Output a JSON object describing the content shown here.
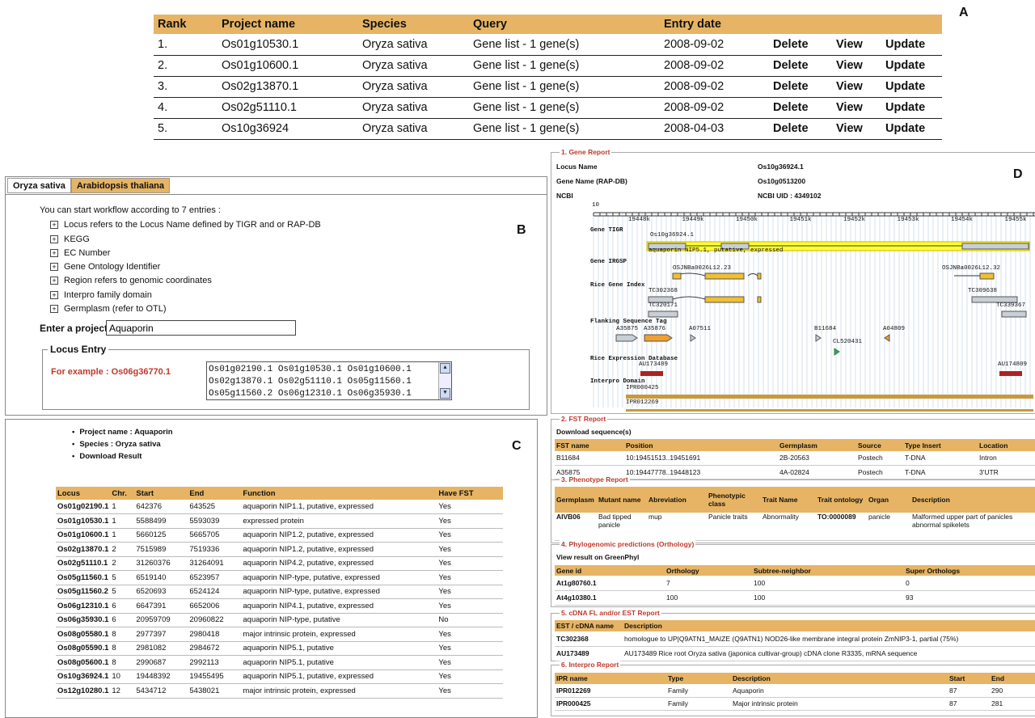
{
  "letters": {
    "a": "A",
    "b": "B",
    "c": "C",
    "d": "D"
  },
  "panelA": {
    "headers": [
      "Rank",
      "Project name",
      "Species",
      "Query",
      "Entry date",
      "",
      "",
      ""
    ],
    "rows": [
      [
        "1.",
        "Os01g10530.1",
        "Oryza sativa",
        "Gene list - 1 gene(s)",
        "2008-09-02",
        "Delete",
        "View",
        "Update"
      ],
      [
        "2.",
        "Os01g10600.1",
        "Oryza sativa",
        "Gene list - 1 gene(s)",
        "2008-09-02",
        "Delete",
        "View",
        "Update"
      ],
      [
        "3.",
        "Os02g13870.1",
        "Oryza sativa",
        "Gene list - 1 gene(s)",
        "2008-09-02",
        "Delete",
        "View",
        "Update"
      ],
      [
        "4.",
        "Os02g51110.1",
        "Oryza sativa",
        "Gene list - 1 gene(s)",
        "2008-09-02",
        "Delete",
        "View",
        "Update"
      ],
      [
        "5.",
        "Os10g36924",
        "Oryza sativa",
        "Gene list - 1 gene(s)",
        "2008-04-03",
        "Delete",
        "View",
        "Update"
      ]
    ]
  },
  "panelB": {
    "tabs": [
      "Oryza sativa",
      "Arabidopsis thaliana"
    ],
    "intro": "You can start workflow according to 7 entries :",
    "items": [
      "Locus refers to the Locus Name defined by TIGR and or RAP-DB",
      "KEGG",
      "EC Number",
      "Gene Ontology Identifier",
      "Region refers to genomic coordinates",
      "Interpro family domain",
      "Germplasm (refer to OTL)"
    ],
    "enter_label": "Enter a project",
    "enter_value": "Aquaporin",
    "locus_label": "Locus Entry",
    "example": "For example : Os06g36770.1",
    "locus_lines": [
      "Os01g02190.1 Os01g10530.1 Os01g10600.1",
      "Os02g13870.1 Os02g51110.1 Os05g11560.1",
      "Os05g11560.2 Os06g12310.1 Os06g35930.1"
    ]
  },
  "panelC": {
    "bullets": [
      "Project name : Aquaporin",
      "Species : Oryza sativa",
      "Download Result"
    ],
    "headers": [
      "Locus",
      "Chr.",
      "Start",
      "End",
      "Function",
      "Have FST"
    ],
    "rows": [
      [
        "Os01g02190.1",
        "1",
        "642376",
        "643525",
        "aquaporin NIP1.1, putative, expressed",
        "Yes"
      ],
      [
        "Os01g10530.1",
        "1",
        "5588499",
        "5593039",
        "expressed protein",
        "Yes"
      ],
      [
        "Os01g10600.1",
        "1",
        "5660125",
        "5665705",
        "aquaporin NIP1.2, putative, expressed",
        "Yes"
      ],
      [
        "Os02g13870.1",
        "2",
        "7515989",
        "7519336",
        "aquaporin NIP1.2, putative, expressed",
        "Yes"
      ],
      [
        "Os02g51110.1",
        "2",
        "31260376",
        "31264091",
        "aquaporin NIP4.2, putative, expressed",
        "Yes"
      ],
      [
        "Os05g11560.1",
        "5",
        "6519140",
        "6523957",
        "aquaporin NIP-type, putative, expressed",
        "Yes"
      ],
      [
        "Os05g11560.2",
        "5",
        "6520693",
        "6524124",
        "aquaporin NIP-type, putative, expressed",
        "Yes"
      ],
      [
        "Os06g12310.1",
        "6",
        "6647391",
        "6652006",
        "aquaporin NIP4.1, putative, expressed",
        "Yes"
      ],
      [
        "Os06g35930.1",
        "6",
        "20959709",
        "20960822",
        "aquaporin NIP-type, putative",
        "No"
      ],
      [
        "Os08g05580.1",
        "8",
        "2977397",
        "2980418",
        "major intrinsic protein, expressed",
        "Yes"
      ],
      [
        "Os08g05590.1",
        "8",
        "2981082",
        "2984672",
        "aquaporin NIP5.1, putative",
        "Yes"
      ],
      [
        "Os08g05600.1",
        "8",
        "2990687",
        "2992113",
        "aquaporin NIP5.1, putative",
        "Yes"
      ],
      [
        "Os10g36924.1",
        "10",
        "19448392",
        "19455495",
        "aquaporin NIP5.1, putative, expressed",
        "Yes"
      ],
      [
        "Os12g10280.1",
        "12",
        "5434712",
        "5438021",
        "major intrinsic protein, expressed",
        "Yes"
      ]
    ]
  },
  "panelD": {
    "s1": {
      "title": "1. Gene Report",
      "locus_label": "Locus Name",
      "locus_value": "Os10g36924.1",
      "gene_label": "Gene Name (RAP-DB)",
      "gene_value": "Os10g0513200",
      "ncbi_label": "NCBI",
      "ncbi_value": "NCBI UID : 4349102",
      "chrom": "10",
      "ticks": [
        "19448k",
        "19449k",
        "19450k",
        "19451k",
        "19452k",
        "19453k",
        "19454k",
        "19455k"
      ],
      "tracks": [
        "Gene TIGR",
        "Gene IRGSP",
        "Rice Gene Index",
        "Flanking Sequence Tag",
        "Rice Expression Database",
        "Interpro Domain"
      ],
      "feat": {
        "tigr": "Os10g36924.1",
        "tigr_desc": "aquaporin NIP5.1, putative, expressed",
        "irgsp1": "OSJNBa0026L12.23",
        "irgsp2": "OSJNBa0026L12.32",
        "tc1": "TC302368",
        "tc2": "TC309638",
        "tc3": "TC320171",
        "tc4": "TC339367",
        "f1": "A35875",
        "f2": "A35876",
        "f3": "A07511",
        "f4": "B11684",
        "f5": "A04809",
        "f6": "CL520431",
        "e1": "AU174809",
        "e2": "AU173489",
        "i1": "IPR000425",
        "i2": "IPR012269"
      }
    },
    "s2": {
      "title": "2. FST Report",
      "sub": "Download sequence(s)",
      "headers": [
        "FST name",
        "Position",
        "Germplasm",
        "Source",
        "Type Insert",
        "Location"
      ],
      "rows": [
        [
          "B11684",
          "10:19451513..19451691",
          "2B-20563",
          "Postech",
          "T-DNA",
          "Intron"
        ],
        [
          "A35875",
          "10:19447778..19448123",
          "4A-02824",
          "Postech",
          "T-DNA",
          "3'UTR"
        ]
      ]
    },
    "s3": {
      "title": "3. Phenotype Report",
      "headers": [
        "Germplasm",
        "Mutant name",
        "Abreviation",
        "Phenotypic class",
        "Trait Name",
        "Trait ontology",
        "Organ",
        "Description"
      ],
      "row": [
        "AIVB06",
        "Bad tipped panicle",
        "mup",
        "Panicle traits",
        "Abnormality",
        "TO:0000089",
        "panicle",
        "Malformed upper part of panicles abnormal spikelets"
      ]
    },
    "s4": {
      "title": "4. Phylogenomic predictions (Orthology)",
      "sub": "View result on GreenPhyl",
      "headers": [
        "Gene id",
        "Orthology",
        "Subtree-neighbor",
        "Super Orthologs"
      ],
      "rows": [
        [
          "At1g80760.1",
          "7",
          "100",
          "0"
        ],
        [
          "At4g10380.1",
          "100",
          "100",
          "93"
        ]
      ]
    },
    "s5": {
      "title": "5. cDNA FL and/or EST Report",
      "headers": [
        "EST / cDNA name",
        "Description"
      ],
      "rows": [
        [
          "TC302368",
          "homologue to UP|Q9ATN1_MAIZE (Q9ATN1) NOD26-like membrane integral protein ZmNIP3-1, partial (75%)"
        ],
        [
          "AU173489",
          "AU173489 Rice root Oryza sativa (japonica cultivar-group) cDNA clone R3335, mRNA sequence"
        ]
      ]
    },
    "s6": {
      "title": "6. Interpro Report",
      "headers": [
        "IPR name",
        "Type",
        "Description",
        "Start",
        "End"
      ],
      "rows": [
        [
          "IPR012269",
          "Family",
          "Aquaporin",
          "87",
          "290"
        ],
        [
          "IPR000425",
          "Family",
          "Major intrinsic protein",
          "87",
          "281"
        ]
      ]
    }
  },
  "colors": {
    "header": "#e6b464",
    "highlight": "#ffff33",
    "red": "#c0392b",
    "gene": "#f0c030",
    "grey": "#c8cfd6",
    "tan": "#c89a3c",
    "est": "#b02020"
  }
}
